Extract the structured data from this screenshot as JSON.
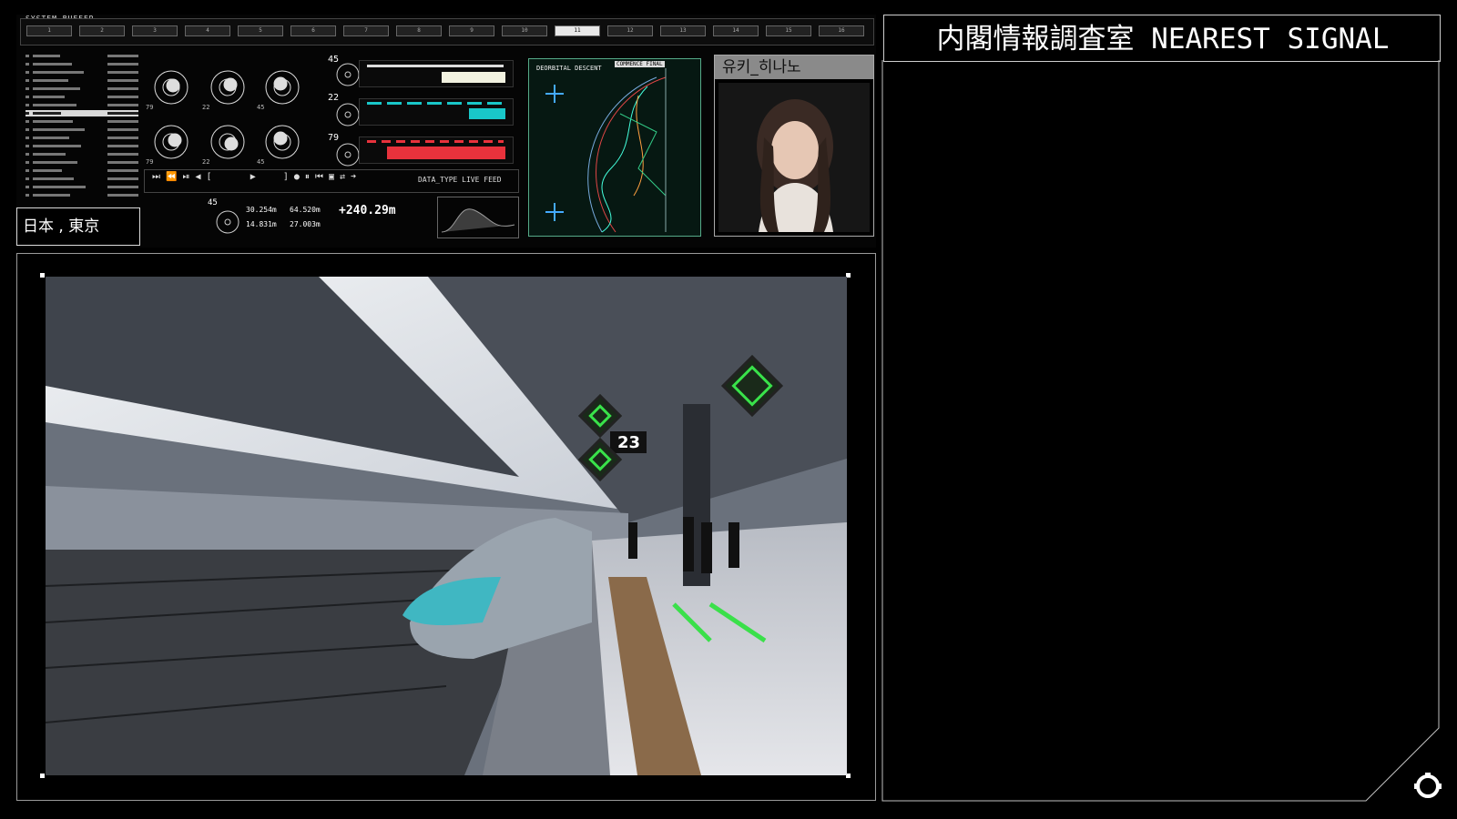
{
  "header": {
    "title": "内閣情報調査室 NEAREST SIGNAL",
    "system_label": "SYSTEM.BUFFER"
  },
  "tabs": [
    "1",
    "2",
    "3",
    "4",
    "5",
    "6",
    "7",
    "8",
    "9",
    "10",
    "11",
    "12",
    "13",
    "14",
    "15",
    "16"
  ],
  "active_tab_index": 10,
  "location": "日本 , 東京",
  "profile": {
    "name": "유키_히나노"
  },
  "gauges": {
    "values": [
      "79",
      "22",
      "45",
      "79",
      "22",
      "45"
    ],
    "side_values": [
      "45",
      "22",
      "79"
    ],
    "bottom_value": "45"
  },
  "readouts": {
    "a1": "30.254m",
    "a2": "64.520m",
    "a3": "14.831m",
    "a4": "27.003m",
    "main": "+240.29m",
    "feed": "DATA_TYPE LIVE FEED"
  },
  "map": {
    "title": "DEORBITAL DESCENT",
    "subtitle": "COMMENCE FINAL"
  },
  "photo": {
    "platform_sign": "23"
  },
  "colors": {
    "accent_green": "#39e24a",
    "bar_cyan": "#19c7c9",
    "bar_red": "#e8323c",
    "border": "#cfcfcf"
  }
}
